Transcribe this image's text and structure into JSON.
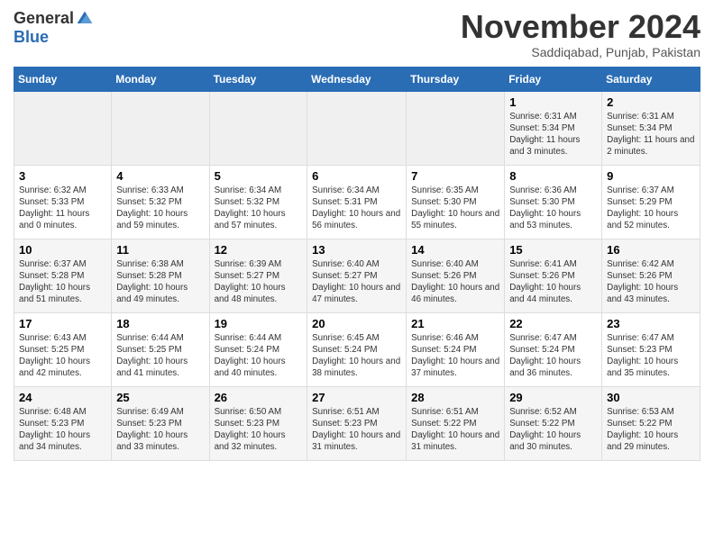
{
  "logo": {
    "general": "General",
    "blue": "Blue"
  },
  "title": "November 2024",
  "location": "Saddiqabad, Punjab, Pakistan",
  "days_of_week": [
    "Sunday",
    "Monday",
    "Tuesday",
    "Wednesday",
    "Thursday",
    "Friday",
    "Saturday"
  ],
  "weeks": [
    [
      {
        "day": "",
        "empty": true
      },
      {
        "day": "",
        "empty": true
      },
      {
        "day": "",
        "empty": true
      },
      {
        "day": "",
        "empty": true
      },
      {
        "day": "",
        "empty": true
      },
      {
        "day": "1",
        "sunrise": "6:31 AM",
        "sunset": "5:34 PM",
        "daylight": "11 hours and 3 minutes."
      },
      {
        "day": "2",
        "sunrise": "6:31 AM",
        "sunset": "5:34 PM",
        "daylight": "11 hours and 2 minutes."
      }
    ],
    [
      {
        "day": "3",
        "sunrise": "6:32 AM",
        "sunset": "5:33 PM",
        "daylight": "11 hours and 0 minutes."
      },
      {
        "day": "4",
        "sunrise": "6:33 AM",
        "sunset": "5:32 PM",
        "daylight": "10 hours and 59 minutes."
      },
      {
        "day": "5",
        "sunrise": "6:34 AM",
        "sunset": "5:32 PM",
        "daylight": "10 hours and 57 minutes."
      },
      {
        "day": "6",
        "sunrise": "6:34 AM",
        "sunset": "5:31 PM",
        "daylight": "10 hours and 56 minutes."
      },
      {
        "day": "7",
        "sunrise": "6:35 AM",
        "sunset": "5:30 PM",
        "daylight": "10 hours and 55 minutes."
      },
      {
        "day": "8",
        "sunrise": "6:36 AM",
        "sunset": "5:30 PM",
        "daylight": "10 hours and 53 minutes."
      },
      {
        "day": "9",
        "sunrise": "6:37 AM",
        "sunset": "5:29 PM",
        "daylight": "10 hours and 52 minutes."
      }
    ],
    [
      {
        "day": "10",
        "sunrise": "6:37 AM",
        "sunset": "5:28 PM",
        "daylight": "10 hours and 51 minutes."
      },
      {
        "day": "11",
        "sunrise": "6:38 AM",
        "sunset": "5:28 PM",
        "daylight": "10 hours and 49 minutes."
      },
      {
        "day": "12",
        "sunrise": "6:39 AM",
        "sunset": "5:27 PM",
        "daylight": "10 hours and 48 minutes."
      },
      {
        "day": "13",
        "sunrise": "6:40 AM",
        "sunset": "5:27 PM",
        "daylight": "10 hours and 47 minutes."
      },
      {
        "day": "14",
        "sunrise": "6:40 AM",
        "sunset": "5:26 PM",
        "daylight": "10 hours and 46 minutes."
      },
      {
        "day": "15",
        "sunrise": "6:41 AM",
        "sunset": "5:26 PM",
        "daylight": "10 hours and 44 minutes."
      },
      {
        "day": "16",
        "sunrise": "6:42 AM",
        "sunset": "5:26 PM",
        "daylight": "10 hours and 43 minutes."
      }
    ],
    [
      {
        "day": "17",
        "sunrise": "6:43 AM",
        "sunset": "5:25 PM",
        "daylight": "10 hours and 42 minutes."
      },
      {
        "day": "18",
        "sunrise": "6:44 AM",
        "sunset": "5:25 PM",
        "daylight": "10 hours and 41 minutes."
      },
      {
        "day": "19",
        "sunrise": "6:44 AM",
        "sunset": "5:24 PM",
        "daylight": "10 hours and 40 minutes."
      },
      {
        "day": "20",
        "sunrise": "6:45 AM",
        "sunset": "5:24 PM",
        "daylight": "10 hours and 38 minutes."
      },
      {
        "day": "21",
        "sunrise": "6:46 AM",
        "sunset": "5:24 PM",
        "daylight": "10 hours and 37 minutes."
      },
      {
        "day": "22",
        "sunrise": "6:47 AM",
        "sunset": "5:24 PM",
        "daylight": "10 hours and 36 minutes."
      },
      {
        "day": "23",
        "sunrise": "6:47 AM",
        "sunset": "5:23 PM",
        "daylight": "10 hours and 35 minutes."
      }
    ],
    [
      {
        "day": "24",
        "sunrise": "6:48 AM",
        "sunset": "5:23 PM",
        "daylight": "10 hours and 34 minutes."
      },
      {
        "day": "25",
        "sunrise": "6:49 AM",
        "sunset": "5:23 PM",
        "daylight": "10 hours and 33 minutes."
      },
      {
        "day": "26",
        "sunrise": "6:50 AM",
        "sunset": "5:23 PM",
        "daylight": "10 hours and 32 minutes."
      },
      {
        "day": "27",
        "sunrise": "6:51 AM",
        "sunset": "5:23 PM",
        "daylight": "10 hours and 31 minutes."
      },
      {
        "day": "28",
        "sunrise": "6:51 AM",
        "sunset": "5:22 PM",
        "daylight": "10 hours and 31 minutes."
      },
      {
        "day": "29",
        "sunrise": "6:52 AM",
        "sunset": "5:22 PM",
        "daylight": "10 hours and 30 minutes."
      },
      {
        "day": "30",
        "sunrise": "6:53 AM",
        "sunset": "5:22 PM",
        "daylight": "10 hours and 29 minutes."
      }
    ]
  ],
  "labels": {
    "sunrise": "Sunrise:",
    "sunset": "Sunset:",
    "daylight": "Daylight:"
  }
}
